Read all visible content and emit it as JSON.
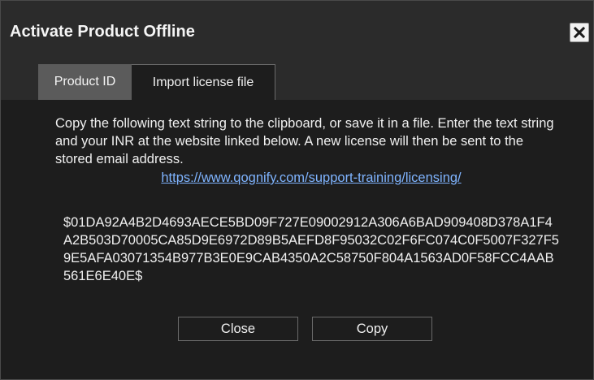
{
  "dialog": {
    "title": "Activate Product Offline",
    "close_icon": "close-icon"
  },
  "tabs": [
    {
      "label": "Product ID",
      "active": true
    },
    {
      "label": "Import license file",
      "active": false
    }
  ],
  "content": {
    "instructions": "Copy the following text string to the clipboard, or save it in a file. Enter the text string and your INR at the website linked below. A new license will then be sent to the stored email address.",
    "link": "https://www.qognify.com/support-training/licensing/",
    "product_code": "$01DA92A4B2D4693AECE5BD09F727E09002912A306A6BAD909408D378A1F4A2B503D70005CA85D9E6972D89B5AEFD8F95032C02F6FC074C0F5007F327F59E5AFA03071354B977B3E0E9CAB4350A2C58750F804A1563AD0F58FCC4AAB561E6E40E$"
  },
  "buttons": {
    "close_label": "Close",
    "copy_label": "Copy"
  },
  "colors": {
    "background": "#1d1d1d",
    "titlebar": "#2b2b2b",
    "active_tab": "#5b5b5b",
    "link": "#7fb4ff"
  }
}
